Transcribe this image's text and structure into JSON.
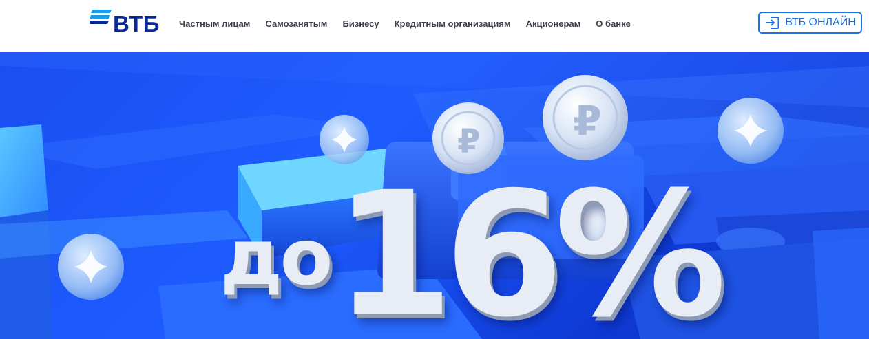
{
  "header": {
    "logo_text": "ВТБ",
    "logo_icon": "vtb-stripes-icon",
    "nav": [
      {
        "label": "Частным лицам"
      },
      {
        "label": "Самозанятым"
      },
      {
        "label": "Бизнесу"
      },
      {
        "label": "Кредитным организациям"
      },
      {
        "label": "Акционерам"
      },
      {
        "label": "О банке"
      }
    ],
    "online_button": {
      "label": "ВТБ ОНЛАЙН",
      "icon": "login-icon"
    }
  },
  "hero": {
    "promo_prefix": "до",
    "promo_value": "16%"
  },
  "colors": {
    "brand": "#0a2896",
    "accent": "#1a73e8",
    "hero_bg": "#1e5cff"
  }
}
